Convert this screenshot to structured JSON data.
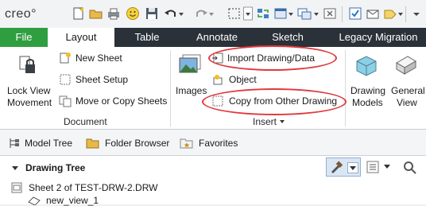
{
  "app": {
    "logo": "creo°"
  },
  "tabs": {
    "file": "File",
    "layout": "Layout",
    "table": "Table",
    "annotate": "Annotate",
    "sketch": "Sketch",
    "legacy": "Legacy Migration"
  },
  "ribbon": {
    "lock_view_movement_line1": "Lock View",
    "lock_view_movement_line2": "Movement",
    "new_sheet": "New Sheet",
    "sheet_setup": "Sheet Setup",
    "move_copy_sheets": "Move or Copy Sheets",
    "document_group": "Document",
    "images": "Images",
    "import_drawing_data": "Import Drawing/Data",
    "object": "Object",
    "copy_from_other_drawing": "Copy from Other Drawing",
    "insert_group": "Insert",
    "drawing_models_line1": "Drawing",
    "drawing_models_line2": "Models",
    "general_view_line1": "General",
    "general_view_line2": "View"
  },
  "panel_tabs": {
    "model_tree": "Model Tree",
    "folder_browser": "Folder Browser",
    "favorites": "Favorites"
  },
  "tree": {
    "title": "Drawing Tree",
    "sheet_item": "Sheet 2 of TEST-DRW-2.DRW",
    "view_item": "new_view_1"
  },
  "colors": {
    "file_tab": "#2f9e3f",
    "tab_bar": "#2a3138",
    "highlight": "#e0393c"
  }
}
